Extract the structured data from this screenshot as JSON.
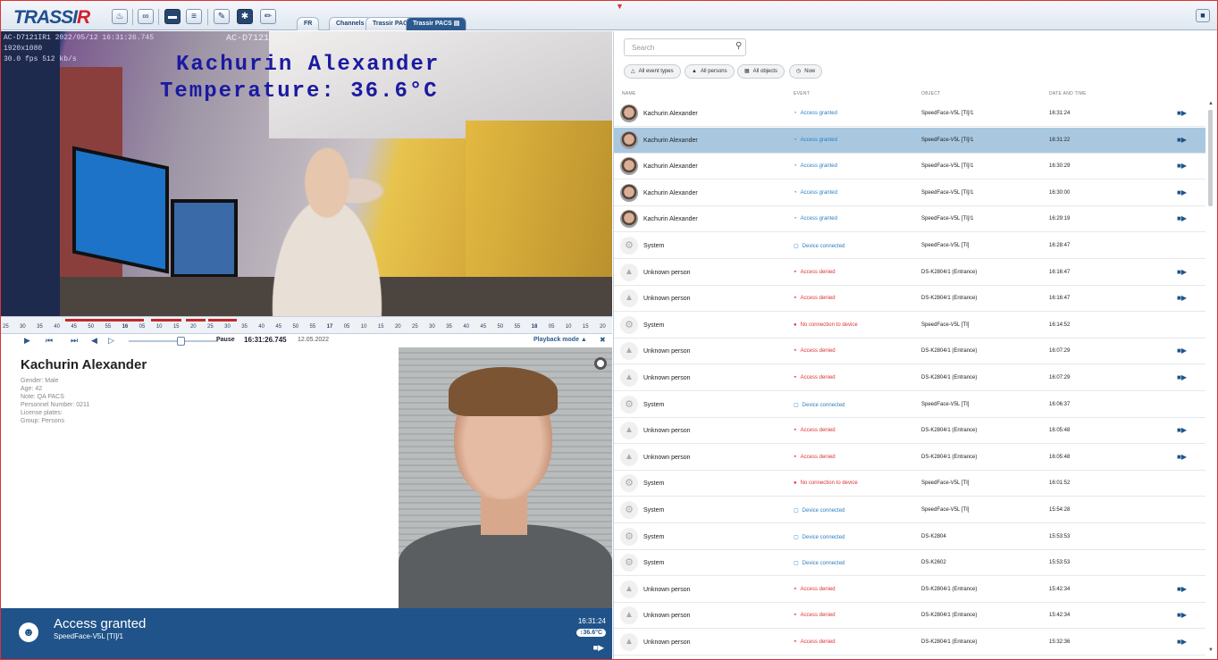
{
  "app": {
    "logo_main": "TRASSI",
    "logo_accent": "R"
  },
  "toolbar": {
    "icons": [
      "bell-icon",
      "record-icon",
      "chat-icon",
      "layout-icon",
      "wrench-icon",
      "gear-icon",
      "edit-icon"
    ],
    "tabs": [
      "FR",
      "Channels",
      "Trassir PACS",
      "Trassir PACS"
    ],
    "active_tab": 3
  },
  "video": {
    "osd_line1": "AC-D7121IR1 2022/05/12 16:31:26.745",
    "osd_line2": "1920x1080",
    "osd_line3": "30.0 fps 512 kb/s",
    "camera_name": "AC-D7121IR1",
    "overlay_name": "Kachurin Alexander",
    "overlay_temp": "Temperature: 36.6°C"
  },
  "timeline": {
    "labels": [
      "25",
      "30",
      "35",
      "40",
      "45",
      "50",
      "55",
      "16",
      "05",
      "10",
      "15",
      "20",
      "25",
      "30",
      "35",
      "40",
      "45",
      "50",
      "55",
      "17",
      "05",
      "10",
      "15",
      "20",
      "25",
      "30",
      "35",
      "40",
      "45",
      "50",
      "55",
      "18",
      "05",
      "10",
      "15",
      "20"
    ],
    "pause_label": "Pause",
    "time": "16:31:26.745",
    "date": "12.05.2022",
    "mode_label": "Playback mode"
  },
  "person": {
    "name": "Kachurin Alexander",
    "attrs": [
      "Gender: Male",
      "Age: 42",
      "Note: QA PACS",
      "Personnel Number: 0211",
      "License plates:",
      "Group: Persons"
    ]
  },
  "banner": {
    "title": "Access granted",
    "subtitle": "SpeedFace-V5L [TI]/1",
    "time": "16:31:24",
    "temp": "36.6°C"
  },
  "events_panel": {
    "search_placeholder": "Search",
    "filters": [
      {
        "icon": "△",
        "label": "All event types"
      },
      {
        "icon": "▲",
        "label": "All persons"
      },
      {
        "icon": "▦",
        "label": "All objects"
      },
      {
        "icon": "◷",
        "label": "Now"
      }
    ],
    "columns": [
      "NAME",
      "EVENT",
      "OBJECT",
      "DATE AND TIME"
    ],
    "rows": [
      {
        "kind": "photo",
        "name": "Kachurin Alexander",
        "event": "Access granted",
        "etype": "granted",
        "object": "SpeedFace-V5L [TI]/1",
        "time": "16:31:24",
        "video": true,
        "selected": false
      },
      {
        "kind": "photo",
        "name": "Kachurin Alexander",
        "event": "Access granted",
        "etype": "granted",
        "object": "SpeedFace-V5L [TI]/1",
        "time": "16:31:22",
        "video": true,
        "selected": true
      },
      {
        "kind": "photo",
        "name": "Kachurin Alexander",
        "event": "Access granted",
        "etype": "granted",
        "object": "SpeedFace-V5L [TI]/1",
        "time": "16:30:29",
        "video": true,
        "selected": false
      },
      {
        "kind": "photo",
        "name": "Kachurin Alexander",
        "event": "Access granted",
        "etype": "granted",
        "object": "SpeedFace-V5L [TI]/1",
        "time": "16:30:00",
        "video": true,
        "selected": false
      },
      {
        "kind": "photo",
        "name": "Kachurin Alexander",
        "event": "Access granted",
        "etype": "granted",
        "object": "SpeedFace-V5L [TI]/1",
        "time": "16:29:19",
        "video": true,
        "selected": false
      },
      {
        "kind": "sys",
        "name": "System",
        "event": "Device connected",
        "etype": "conn",
        "object": "SpeedFace-V5L [TI]",
        "time": "16:28:47",
        "video": false,
        "selected": false
      },
      {
        "kind": "unk",
        "name": "Unknown person",
        "event": "Access denied",
        "etype": "denied",
        "object": "DS-K2804/1 (Entrance)",
        "time": "16:16:47",
        "video": true,
        "selected": false
      },
      {
        "kind": "unk",
        "name": "Unknown person",
        "event": "Access denied",
        "etype": "denied",
        "object": "DS-K2804/1 (Entrance)",
        "time": "16:16:47",
        "video": true,
        "selected": false
      },
      {
        "kind": "sys",
        "name": "System",
        "event": "No connection to device",
        "etype": "noconn",
        "object": "SpeedFace-V5L [TI]",
        "time": "16:14:52",
        "video": false,
        "selected": false
      },
      {
        "kind": "unk",
        "name": "Unknown person",
        "event": "Access denied",
        "etype": "denied",
        "object": "DS-K2804/1 (Entrance)",
        "time": "16:07:29",
        "video": true,
        "selected": false
      },
      {
        "kind": "unk",
        "name": "Unknown person",
        "event": "Access denied",
        "etype": "denied",
        "object": "DS-K2804/1 (Entrance)",
        "time": "16:07:29",
        "video": true,
        "selected": false
      },
      {
        "kind": "sys",
        "name": "System",
        "event": "Device connected",
        "etype": "conn",
        "object": "SpeedFace-V5L [TI]",
        "time": "16:06:37",
        "video": false,
        "selected": false
      },
      {
        "kind": "unk",
        "name": "Unknown person",
        "event": "Access denied",
        "etype": "denied",
        "object": "DS-K2804/1 (Entrance)",
        "time": "16:05:48",
        "video": true,
        "selected": false
      },
      {
        "kind": "unk",
        "name": "Unknown person",
        "event": "Access denied",
        "etype": "denied",
        "object": "DS-K2804/1 (Entrance)",
        "time": "16:05:48",
        "video": true,
        "selected": false
      },
      {
        "kind": "sys",
        "name": "System",
        "event": "No connection to device",
        "etype": "noconn",
        "object": "SpeedFace-V5L [TI]",
        "time": "16:01:52",
        "video": false,
        "selected": false
      },
      {
        "kind": "sys",
        "name": "System",
        "event": "Device connected",
        "etype": "conn",
        "object": "SpeedFace-V5L [TI]",
        "time": "15:54:28",
        "video": false,
        "selected": false
      },
      {
        "kind": "sys",
        "name": "System",
        "event": "Device connected",
        "etype": "conn",
        "object": "DS-K2804",
        "time": "15:53:53",
        "video": false,
        "selected": false
      },
      {
        "kind": "sys",
        "name": "System",
        "event": "Device connected",
        "etype": "conn",
        "object": "DS-K2602",
        "time": "15:53:53",
        "video": false,
        "selected": false
      },
      {
        "kind": "unk",
        "name": "Unknown person",
        "event": "Access denied",
        "etype": "denied",
        "object": "DS-K2804/1 (Entrance)",
        "time": "15:42:34",
        "video": true,
        "selected": false
      },
      {
        "kind": "unk",
        "name": "Unknown person",
        "event": "Access denied",
        "etype": "denied",
        "object": "DS-K2804/1 (Entrance)",
        "time": "15:42:34",
        "video": true,
        "selected": false
      },
      {
        "kind": "unk",
        "name": "Unknown person",
        "event": "Access denied",
        "etype": "denied",
        "object": "DS-K2804/1 (Entrance)",
        "time": "15:32:36",
        "video": true,
        "selected": false
      }
    ]
  },
  "colors": {
    "accent": "#1f5389",
    "denied": "#dd3333",
    "granted": "#2b7fc3",
    "selected_row": "#a9c8e0"
  }
}
